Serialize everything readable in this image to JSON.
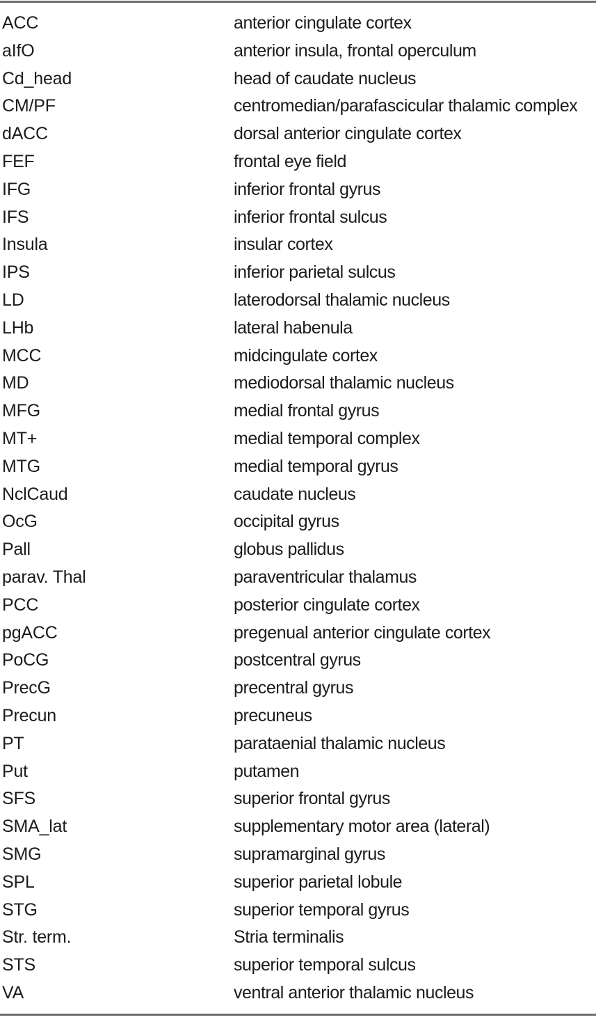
{
  "table": {
    "name": "abbreviations-list",
    "columns": [
      "abbreviation",
      "definition"
    ],
    "rules": {
      "top": true,
      "bottom": true,
      "color": "#6f6f6f"
    },
    "rows": [
      {
        "abbr": "ACC",
        "desc": "anterior cingulate cortex"
      },
      {
        "abbr": "aIfO",
        "desc": "anterior insula, frontal operculum"
      },
      {
        "abbr": "Cd_head",
        "desc": "head of caudate nucleus"
      },
      {
        "abbr": "CM/PF",
        "desc": "centromedian/parafascicular thalamic complex"
      },
      {
        "abbr": "dACC",
        "desc": "dorsal anterior cingulate cortex"
      },
      {
        "abbr": "FEF",
        "desc": "frontal eye field"
      },
      {
        "abbr": "IFG",
        "desc": "inferior frontal gyrus"
      },
      {
        "abbr": "IFS",
        "desc": "inferior frontal sulcus"
      },
      {
        "abbr": "Insula",
        "desc": "insular cortex"
      },
      {
        "abbr": "IPS",
        "desc": "inferior parietal sulcus"
      },
      {
        "abbr": "LD",
        "desc": "laterodorsal thalamic nucleus"
      },
      {
        "abbr": "LHb",
        "desc": "lateral habenula"
      },
      {
        "abbr": "MCC",
        "desc": "midcingulate cortex"
      },
      {
        "abbr": "MD",
        "desc": "mediodorsal thalamic nucleus"
      },
      {
        "abbr": "MFG",
        "desc": "medial frontal gyrus"
      },
      {
        "abbr": "MT+",
        "desc": "medial temporal complex"
      },
      {
        "abbr": "MTG",
        "desc": "medial temporal gyrus"
      },
      {
        "abbr": "NclCaud",
        "desc": "caudate nucleus"
      },
      {
        "abbr": "OcG",
        "desc": "occipital gyrus"
      },
      {
        "abbr": "Pall",
        "desc": "globus pallidus"
      },
      {
        "abbr": "parav. Thal",
        "desc": "paraventricular thalamus"
      },
      {
        "abbr": "PCC",
        "desc": "posterior cingulate cortex"
      },
      {
        "abbr": "pgACC",
        "desc": "pregenual anterior cingulate cortex"
      },
      {
        "abbr": "PoCG",
        "desc": "postcentral gyrus"
      },
      {
        "abbr": "PrecG",
        "desc": "precentral gyrus"
      },
      {
        "abbr": "Precun",
        "desc": "precuneus"
      },
      {
        "abbr": "PT",
        "desc": "parataenial thalamic nucleus"
      },
      {
        "abbr": "Put",
        "desc": "putamen"
      },
      {
        "abbr": "SFS",
        "desc": "superior frontal gyrus"
      },
      {
        "abbr": "SMA_lat",
        "desc": "supplementary motor area (lateral)"
      },
      {
        "abbr": "SMG",
        "desc": "supramarginal gyrus"
      },
      {
        "abbr": "SPL",
        "desc": "superior parietal lobule"
      },
      {
        "abbr": "STG",
        "desc": "superior temporal gyrus"
      },
      {
        "abbr": "Str. term.",
        "desc": "Stria terminalis"
      },
      {
        "abbr": "STS",
        "desc": "superior temporal sulcus"
      },
      {
        "abbr": "VA",
        "desc": "ventral anterior thalamic nucleus"
      }
    ]
  }
}
